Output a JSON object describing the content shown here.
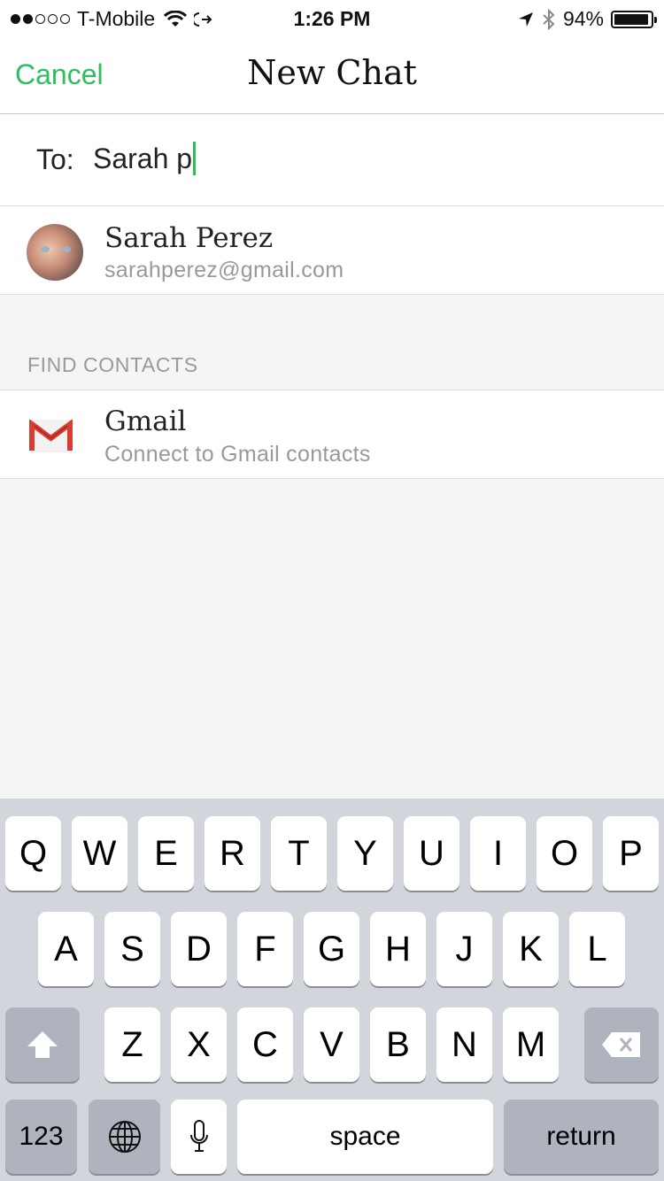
{
  "status_bar": {
    "carrier": "T-Mobile",
    "time": "1:26 PM",
    "battery_percent": "94%",
    "battery_level": 0.94,
    "signal_filled": 2,
    "signal_total": 5
  },
  "nav": {
    "cancel_label": "Cancel",
    "title": "New Chat"
  },
  "to_field": {
    "label": "To:",
    "value": "Sarah p"
  },
  "result": {
    "name": "Sarah Perez",
    "email": "sarahperez@gmail.com"
  },
  "find_contacts": {
    "header": "FIND CONTACTS",
    "gmail_title": "Gmail",
    "gmail_subtitle": "Connect to Gmail contacts"
  },
  "keyboard": {
    "row1": [
      "Q",
      "W",
      "E",
      "R",
      "T",
      "Y",
      "U",
      "I",
      "O",
      "P"
    ],
    "row2": [
      "A",
      "S",
      "D",
      "F",
      "G",
      "H",
      "J",
      "K",
      "L"
    ],
    "row3": [
      "Z",
      "X",
      "C",
      "V",
      "B",
      "N",
      "M"
    ],
    "numbers_label": "123",
    "space_label": "space",
    "return_label": "return"
  },
  "colors": {
    "accent": "#2dbe60",
    "keyboard_bg": "#d2d5db"
  }
}
